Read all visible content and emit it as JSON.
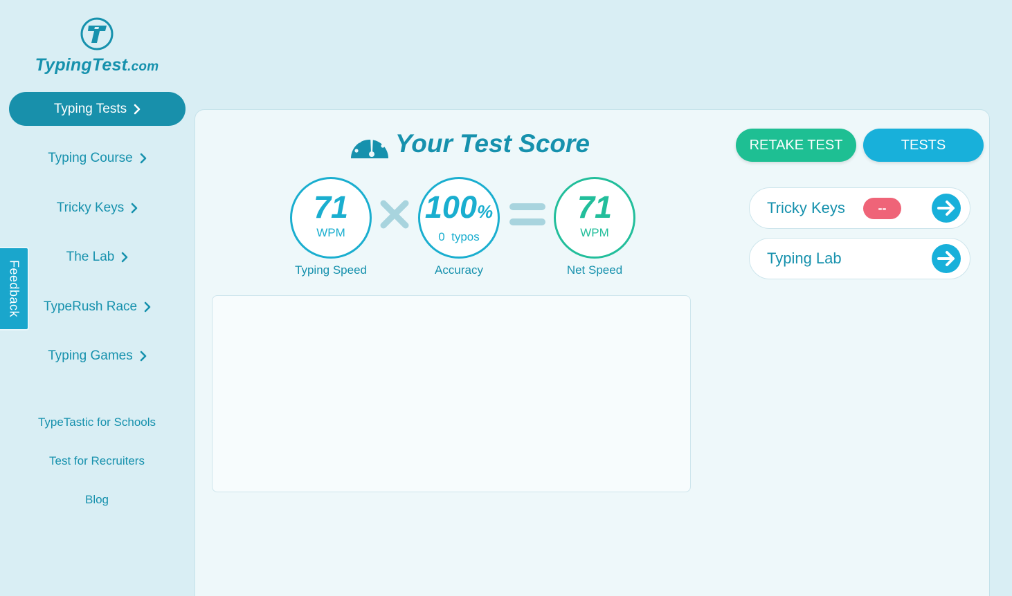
{
  "logo": {
    "text_main": "TypingTest",
    "text_suffix": ".com"
  },
  "nav": {
    "items": [
      {
        "label": "Typing Tests",
        "active": true
      },
      {
        "label": "Typing Course"
      },
      {
        "label": "Tricky Keys"
      },
      {
        "label": "The Lab"
      },
      {
        "label": "TypeRush Race"
      },
      {
        "label": "Typing Games"
      }
    ],
    "links": [
      "TypeTastic for Schools",
      "Test for Recruiters",
      "Blog"
    ]
  },
  "feedback": {
    "label": "Feedback"
  },
  "score": {
    "title": "Your Test Score",
    "typing_speed": {
      "value": "71",
      "unit": "WPM",
      "caption": "Typing Speed"
    },
    "accuracy": {
      "value": "100",
      "percent": "%",
      "typos": "0  typos",
      "caption": "Accuracy"
    },
    "net_speed": {
      "value": "71",
      "unit": "WPM",
      "caption": "Net Speed"
    }
  },
  "actions": {
    "retake_label": "RETAKE TEST",
    "tests_label": "TESTS"
  },
  "cards": [
    {
      "label": "Tricky Keys",
      "badge": "--"
    },
    {
      "label": "Typing Lab"
    }
  ],
  "colors": {
    "background": "#d9eef4",
    "primary": "#1691ad",
    "accent_blue": "#18b0da",
    "accent_green": "#1ebf93",
    "badge_red": "#ef6478"
  },
  "icons": [
    "logo-icon",
    "chevron-right-icon",
    "gauge-icon",
    "times-icon",
    "equals-icon",
    "arrow-right-circle-icon"
  ]
}
